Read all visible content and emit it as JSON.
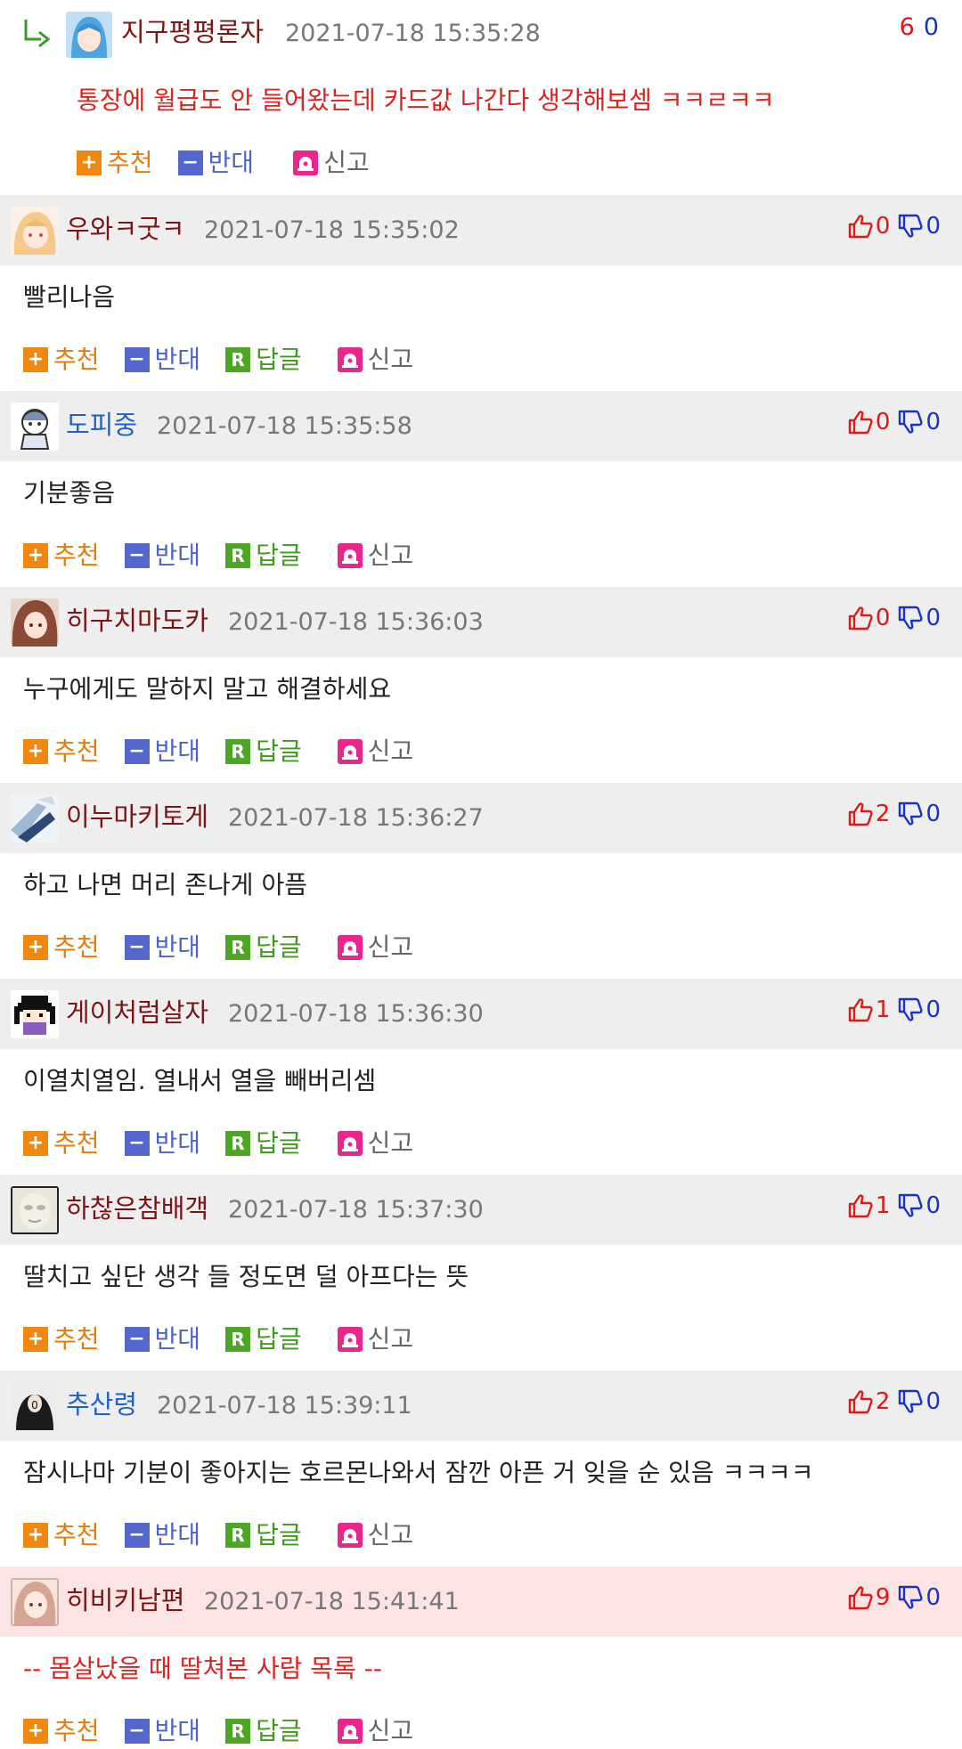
{
  "reply": {
    "author": "지구평평론자",
    "time": "2021-07-18 15:35:28",
    "up": "6",
    "down": "0",
    "body": "통장에 월급도 안 들어왔는데 카드값 나간다 생각해보셈 ㅋㅋㄹㅋㅋ",
    "actions": {
      "recommend": "추천",
      "oppose": "반대",
      "report": "신고"
    }
  },
  "actions": {
    "recommend": "추천",
    "oppose": "반대",
    "reply": "답글",
    "report": "신고",
    "reply_icon_letter": "R"
  },
  "colors": {
    "author_red": "#7a1416",
    "author_blue": "#1f62c6",
    "up_red": "#e01818",
    "down_blue": "#1a32c8",
    "best_header": "#fde4e4",
    "header_gray": "#eeeeee"
  },
  "comments": [
    {
      "author": "우와ㅋ굿ㅋ",
      "author_color": "red",
      "time": "2021-07-18 15:35:02",
      "up": "0",
      "down": "0",
      "body": "빨리나음",
      "avatar": "anime-girl-blonde"
    },
    {
      "author": "도피중",
      "author_color": "blue",
      "time": "2021-07-18 15:35:58",
      "up": "0",
      "down": "0",
      "body": "기분좋음",
      "avatar": "chibi-sketch"
    },
    {
      "author": "히구치마도카",
      "author_color": "red",
      "time": "2021-07-18 15:36:03",
      "up": "0",
      "down": "0",
      "body": "누구에게도 말하지 말고 해결하세요",
      "avatar": "anime-girl-brown"
    },
    {
      "author": "이누마키토게",
      "author_color": "red",
      "time": "2021-07-18 15:36:27",
      "up": "2",
      "down": "0",
      "body": "하고 나면 머리 존나게 아픔",
      "avatar": "blue-white-art"
    },
    {
      "author": "게이처럼살자",
      "author_color": "red",
      "time": "2021-07-18 15:36:30",
      "up": "1",
      "down": "0",
      "body": "이열치열임. 열내서 열을 빼버리셈",
      "avatar": "pixel-character"
    },
    {
      "author": "하찮은참배객",
      "author_color": "red",
      "time": "2021-07-18 15:37:30",
      "up": "1",
      "down": "0",
      "body": "딸치고 싶단 생각 들 정도면 덜 아프다는 뜻",
      "avatar": "blurred-face"
    },
    {
      "author": "추산령",
      "author_color": "blue",
      "time": "2021-07-18 15:39:11",
      "up": "2",
      "down": "0",
      "body": "잠시나마 기분이 좋아지는 호르몬나와서 잠깐 아픈 거 잊을 순 있음 ㅋㅋㅋㅋ",
      "avatar": "dark-figure"
    },
    {
      "author": "히비키남편",
      "author_color": "red",
      "time": "2021-07-18 15:41:41",
      "up": "9",
      "down": "0",
      "body": "-- 몸살났을 때 딸쳐본 사람 목록 --",
      "avatar": "anime-girl-pink",
      "best": true
    }
  ]
}
